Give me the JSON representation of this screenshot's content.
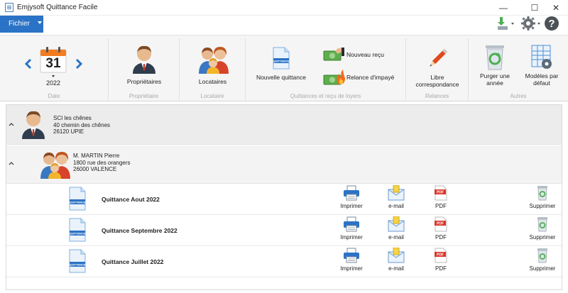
{
  "window": {
    "title": "Emjysoft Quittance Facile",
    "minimize": "—",
    "maximize": "☐",
    "close": "✕"
  },
  "menu": {
    "fichier": "Fichier",
    "icons": [
      "download-icon",
      "settings-gear-icon",
      "help-icon"
    ]
  },
  "ribbon": {
    "date": {
      "day": "31",
      "year": "2022",
      "group": "Date"
    },
    "proprietaires": {
      "label": "Propriétaires",
      "group": "Propriétaire"
    },
    "locataires": {
      "label": "Locataires",
      "group": "Locataire"
    },
    "quittances": {
      "nouvelle": "Nouvelle quittance",
      "nouveau_recu": "Nouveau reçu",
      "relance": "Relance d'impayé",
      "group": "Quittances et reçu de loyers"
    },
    "relances": {
      "libre": "Libre correspondance",
      "group": "Relances"
    },
    "autres": {
      "purger": "Purger une année",
      "modeles": "Modèles par défaut",
      "group": "Autres"
    }
  },
  "owner": {
    "name": "SCI les chênes",
    "address": "40 chemin des chênes",
    "city": "26120 UPIE"
  },
  "tenant": {
    "name": "M. MARTIN Pierre",
    "address": "1800 rue des orangers",
    "city": "26000 VALENCE"
  },
  "receipts": [
    {
      "title": "Quittance Aout 2022"
    },
    {
      "title": "Quittance Septembre 2022"
    },
    {
      "title": "Quittance Juillet 2022"
    }
  ],
  "actions": {
    "print": "Imprimer",
    "email": "e-mail",
    "pdf": "PDF",
    "delete": "Supprimer",
    "pdf_badge": "PDF",
    "doc_badge": "QUITTANCE"
  },
  "colors": {
    "accent": "#2b73c6",
    "ribbon": "#f5f5f5"
  }
}
